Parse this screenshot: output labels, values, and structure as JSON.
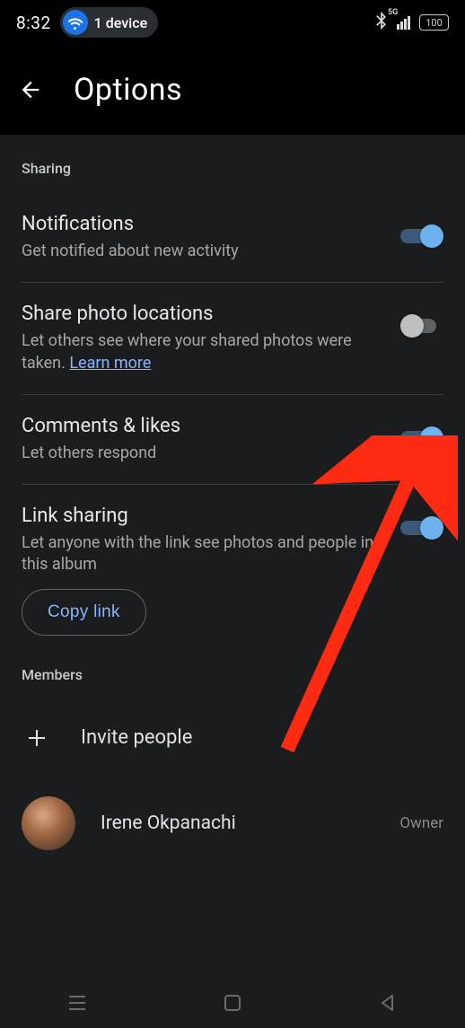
{
  "status": {
    "time": "8:32",
    "device_count": "1 device",
    "battery": "100"
  },
  "header": {
    "title": "Options"
  },
  "sections": {
    "sharing_label": "Sharing",
    "members_label": "Members"
  },
  "settings": {
    "notifications": {
      "title": "Notifications",
      "sub": "Get notified about new activity",
      "on": true
    },
    "share_photo_locations": {
      "title": "Share photo locations",
      "sub_pre": "Let others see where your shared photos were taken. ",
      "learn_more": "Learn more",
      "on": false
    },
    "comments_likes": {
      "title": "Comments & likes",
      "sub": "Let others respond",
      "on": true
    },
    "link_sharing": {
      "title": "Link sharing",
      "sub": "Let anyone with the link see photos and people in this album",
      "copy_button": "Copy link",
      "on": true
    }
  },
  "invite": {
    "label": "Invite people"
  },
  "members": [
    {
      "name": "Irene Okpanachi",
      "role": "Owner"
    }
  ]
}
